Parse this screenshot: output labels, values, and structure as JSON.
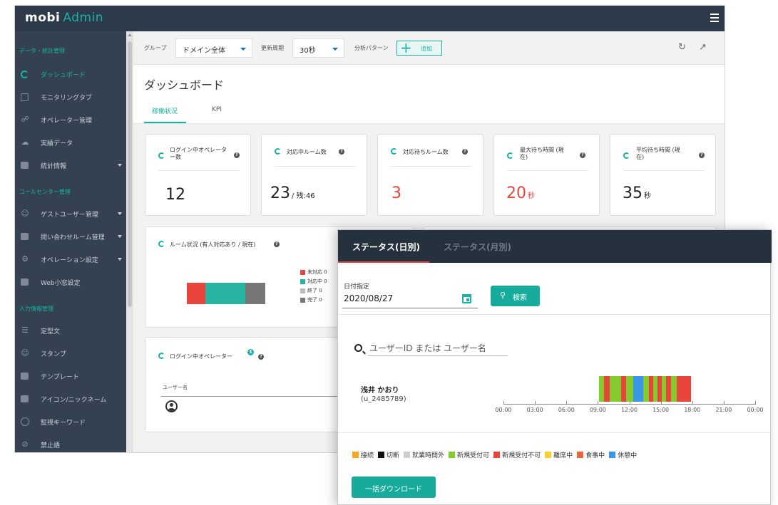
{
  "app": {
    "logo_primary": "mobi",
    "logo_secondary": "Admin"
  },
  "sidebar": {
    "sections": [
      {
        "label": "データ・統計管理"
      },
      {
        "label": "コールセンター管理"
      },
      {
        "label": "入力情報管理"
      }
    ],
    "items": [
      {
        "label": "ダッシュボード",
        "icon": "dashboard-icon",
        "active": true
      },
      {
        "label": "モニタリングタブ",
        "icon": "monitoring-icon"
      },
      {
        "label": "オペレーター管理",
        "icon": "headset-icon"
      },
      {
        "label": "実績データ",
        "icon": "cloud-upload-icon"
      },
      {
        "label": "統計情報",
        "icon": "chart-icon"
      },
      {
        "label": "ゲストユーザー管理",
        "icon": "user-icon"
      },
      {
        "label": "問い合わせルーム管理",
        "icon": "chat-icon"
      },
      {
        "label": "オペレーション設定",
        "icon": "gear-icon"
      },
      {
        "label": "Web小窓設定",
        "icon": "window-icon"
      },
      {
        "label": "定型文",
        "icon": "list-icon"
      },
      {
        "label": "スタンプ",
        "icon": "smiley-icon"
      },
      {
        "label": "テンプレート",
        "icon": "image-icon"
      },
      {
        "label": "アイコン/ニックネーム",
        "icon": "badge-icon"
      },
      {
        "label": "監視キーワード",
        "icon": "alert-icon"
      },
      {
        "label": "禁止語",
        "icon": "forbidden-icon"
      }
    ]
  },
  "filters": {
    "group_label": "グループ",
    "group_value": "ドメイン全体",
    "refresh_label": "更新周期",
    "refresh_value": "30秒",
    "pattern_label": "分析パターン",
    "add_label": "追加"
  },
  "page": {
    "title": "ダッシュボード",
    "tabs": [
      {
        "label": "稼働状況",
        "active": true
      },
      {
        "label": "KPI"
      }
    ]
  },
  "kpis": [
    {
      "label": "ログイン中オペレーター数",
      "value": "12",
      "unit": "",
      "color": "#222222"
    },
    {
      "label": "対応中ルーム数",
      "value": "23",
      "unit": "/ 残:46",
      "color": "#222222"
    },
    {
      "label": "対応待ちルーム数",
      "value": "3",
      "unit": "",
      "color": "#e8453c"
    },
    {
      "label": "最大待ち時間 (現在)",
      "value": "20",
      "unit": "秒",
      "color": "#e8453c"
    },
    {
      "label": "平均待ち時間 (現在)",
      "value": "35",
      "unit": "秒",
      "color": "#222222"
    }
  ],
  "room_status": {
    "title": "ルーム状況 (有人対応あり / 現在)",
    "bar": [
      {
        "fraction": 0.24,
        "color": "#e8453c"
      },
      {
        "fraction": 0.51,
        "color": "#26b3a0"
      },
      {
        "fraction": 0.25,
        "color": "#777777"
      }
    ],
    "legend": [
      {
        "label": "未対応 0",
        "color": "#e8453c"
      },
      {
        "label": "対応中 0",
        "color": "#26b3a0"
      },
      {
        "label": "終了 0",
        "color": "#bbbbbb"
      },
      {
        "label": "完了 0",
        "color": "#777777"
      }
    ]
  },
  "operators": {
    "title": "ログイン中オペレーター",
    "badge": "1",
    "col_user": "ユーザー名"
  },
  "overlay": {
    "tabs": [
      {
        "label": "ステータス(日別)",
        "active": true
      },
      {
        "label": "ステータス(月別)"
      }
    ],
    "date_label": "日付指定",
    "date_value": "2020/08/27",
    "search_button": "検索",
    "search_placeholder": "ユーザーID または ユーザー名",
    "user_name": "浅井 かおり",
    "user_id": "(u_2485789)",
    "timeline": {
      "ticks": [
        "00:00",
        "03:00",
        "06:00",
        "09:00",
        "12:00",
        "15:00",
        "18:00",
        "21:00",
        "00:00"
      ],
      "segments": [
        {
          "start": 9.1,
          "end": 9.6,
          "color": "#84cc2e"
        },
        {
          "start": 9.6,
          "end": 10.1,
          "color": "#e8453c"
        },
        {
          "start": 10.1,
          "end": 11.2,
          "color": "#84cc2e"
        },
        {
          "start": 11.2,
          "end": 11.7,
          "color": "#e8453c"
        },
        {
          "start": 11.7,
          "end": 12.4,
          "color": "#84cc2e"
        },
        {
          "start": 12.4,
          "end": 13.3,
          "color": "#3b96e8"
        },
        {
          "start": 13.3,
          "end": 13.9,
          "color": "#84cc2e"
        },
        {
          "start": 13.9,
          "end": 14.3,
          "color": "#e8453c"
        },
        {
          "start": 14.3,
          "end": 14.7,
          "color": "#84cc2e"
        },
        {
          "start": 14.7,
          "end": 15.1,
          "color": "#e8453c"
        },
        {
          "start": 15.1,
          "end": 15.5,
          "color": "#84cc2e"
        },
        {
          "start": 15.5,
          "end": 16.0,
          "color": "#e8453c"
        },
        {
          "start": 16.0,
          "end": 16.5,
          "color": "#84cc2e"
        },
        {
          "start": 16.5,
          "end": 17.9,
          "color": "#e8453c"
        }
      ]
    },
    "legend": [
      {
        "label": "接続",
        "color": "#f5a623"
      },
      {
        "label": "切断",
        "color": "#111111"
      },
      {
        "label": "就業時間外",
        "color": "#cccccc"
      },
      {
        "label": "新規受付可",
        "color": "#84cc2e"
      },
      {
        "label": "新規受付不可",
        "color": "#e8453c"
      },
      {
        "label": "離席中",
        "color": "#f7d02c"
      },
      {
        "label": "食事中",
        "color": "#f0643c"
      },
      {
        "label": "休憩中",
        "color": "#3b96e8"
      }
    ],
    "download_button": "一括ダウンロード"
  }
}
